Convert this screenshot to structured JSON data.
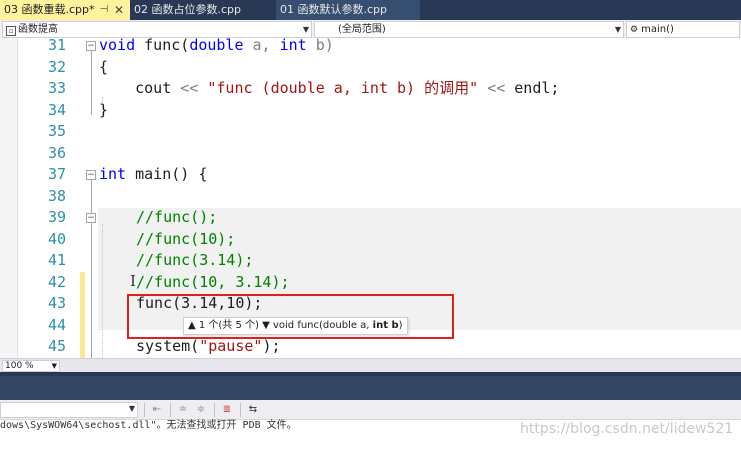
{
  "tabs": [
    {
      "label": "03 函数重载.cpp*",
      "active": true
    },
    {
      "label": "02 函数占位参数.cpp",
      "active": false
    },
    {
      "label": "01 函数默认参数.cpp",
      "active": false
    }
  ],
  "tab_icons": {
    "pin": "pin-icon",
    "close": "close-icon"
  },
  "navbar": {
    "project": "函数提高",
    "scope": "(全局范围)",
    "member": "main()"
  },
  "editor": {
    "line_numbers": [
      "31",
      "32",
      "33",
      "34",
      "35",
      "36",
      "37",
      "38",
      "39",
      "40",
      "41",
      "42",
      "43",
      "44",
      "45"
    ],
    "lines": {
      "l31": {
        "kw": "void",
        "mid": " func(",
        "kw2": "double",
        "p1": " a, ",
        "kw3": "int",
        "p2": " b)"
      },
      "l32": "{",
      "l33": {
        "pre": "    cout ",
        "op1": "<<",
        "str": " \"func (double a, int b) 的调用\" ",
        "op2": "<<",
        "post": " endl;"
      },
      "l34": "}",
      "l37": {
        "kw": "int",
        "rest": " main() {"
      },
      "l39": "//func();",
      "l40": "//func(10);",
      "l41": "//func(3.14);",
      "l42": "//func(10, 3.14);",
      "l43": "func(3.14,10);",
      "l45": {
        "pre": "system(",
        "str": "\"pause\"",
        "post": ");"
      }
    },
    "tooltip": {
      "prefix": "▲ 1 个(共 5 个) ▼ void func(double a, ",
      "bold": "int b",
      "suffix": ")"
    }
  },
  "zoom": "100 %",
  "watermark": "https://blog.csdn.net/lidew521",
  "output_fragment": "dows\\SysWOW64\\sechost.dll\"。无法查找或打开 PDB 文件。",
  "colors": {
    "tab_active": "#fff29d",
    "tab_strip": "#293955",
    "keyword": "#0000ff",
    "string": "#a31515",
    "comment": "#008000",
    "line_number": "#2b91af",
    "annotation": "#e0201e"
  }
}
